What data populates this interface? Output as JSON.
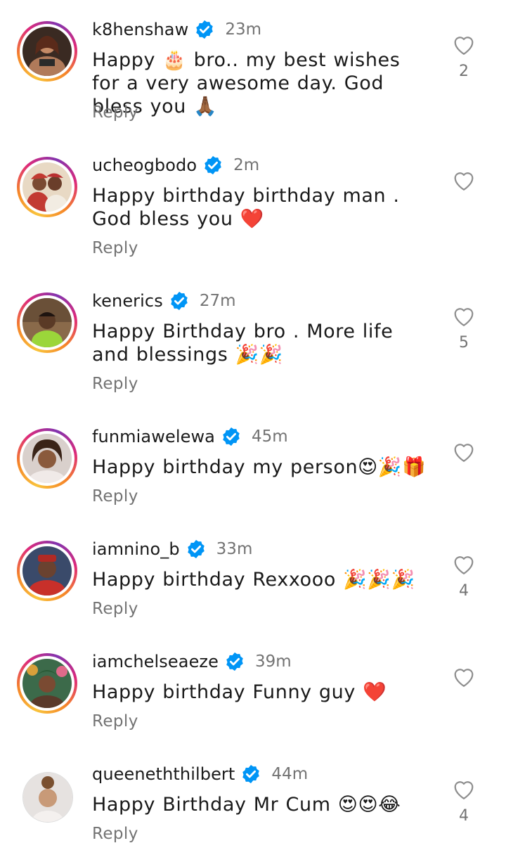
{
  "comments": [
    {
      "username": "k8henshaw",
      "time": "23m",
      "text": "Happy 🎂 bro.. my best wishes for a very awesome day. God bless you 🙏🏾",
      "reply_label": "Reply",
      "like_count": "2",
      "avatar_icon": "avatar-k8henshaw",
      "has_story_ring": true
    },
    {
      "username": "ucheogbodo",
      "time": "2m",
      "text": "Happy birthday birthday man . God bless you ❤️",
      "reply_label": "Reply",
      "like_count": "",
      "avatar_icon": "avatar-ucheogbodo",
      "has_story_ring": true
    },
    {
      "username": "kenerics",
      "time": "27m",
      "text": "Happy Birthday bro . More life and blessings 🎉🎉",
      "reply_label": "Reply",
      "like_count": "5",
      "avatar_icon": "avatar-kenerics",
      "has_story_ring": true
    },
    {
      "username": "funmiawelewa",
      "time": "45m",
      "text": "Happy birthday my person😍🎉🎁",
      "reply_label": "Reply",
      "like_count": "",
      "avatar_icon": "avatar-funmiawelewa",
      "has_story_ring": true
    },
    {
      "username": "iamnino_b",
      "time": "33m",
      "text": "Happy birthday Rexxooo 🎉🎉🎉",
      "reply_label": "Reply",
      "like_count": "4",
      "avatar_icon": "avatar-iamnino_b",
      "has_story_ring": true
    },
    {
      "username": "iamchelseaeze",
      "time": "39m",
      "text": "Happy birthday Funny guy ❤️",
      "reply_label": "Reply",
      "like_count": "",
      "avatar_icon": "avatar-iamchelseaeze",
      "has_story_ring": true
    },
    {
      "username": "queeneththilbert",
      "time": "44m",
      "text": "Happy Birthday Mr Cum 😍😍😂",
      "reply_label": "Reply",
      "like_count": "4",
      "avatar_icon": "avatar-queenethhilbert",
      "has_story_ring": false
    }
  ],
  "colors": {
    "verified_blue": "#0095f6",
    "secondary_text": "#737373",
    "primary_text": "#1a1a1a",
    "heart_outline": "#8e8e8e"
  },
  "icons": {
    "verified": "verified-badge-icon",
    "like": "heart-outline-icon"
  }
}
